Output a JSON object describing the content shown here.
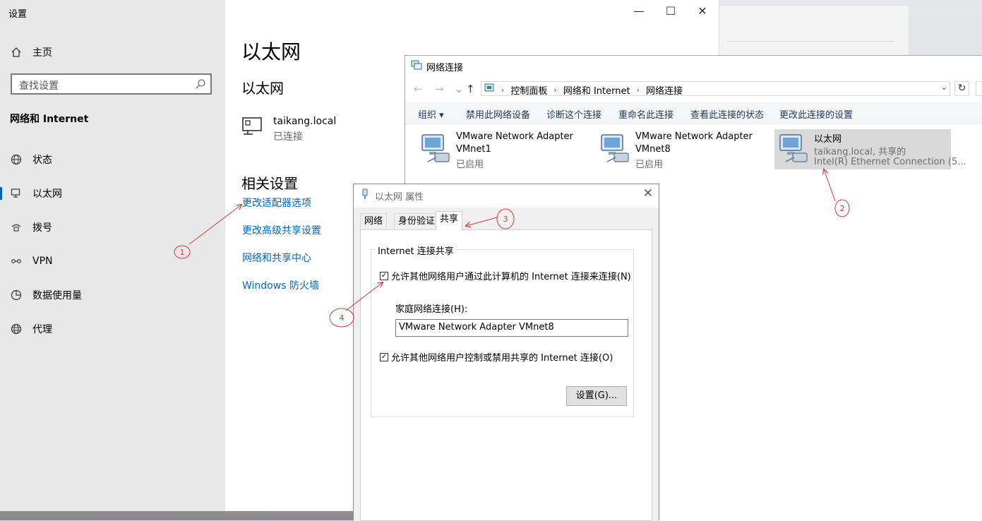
{
  "settings": {
    "window_title": "设置",
    "home_label": "主页",
    "search_placeholder": "查找设置",
    "section_title": "网络和 Internet",
    "nav": [
      {
        "label": "状态",
        "icon": "globe-status-icon"
      },
      {
        "label": "以太网",
        "icon": "ethernet-icon"
      },
      {
        "label": "拨号",
        "icon": "dialup-icon"
      },
      {
        "label": "VPN",
        "icon": "vpn-icon"
      },
      {
        "label": "数据使用量",
        "icon": "data-usage-icon"
      },
      {
        "label": "代理",
        "icon": "globe-proxy-icon"
      }
    ],
    "selected_nav": "以太网",
    "main": {
      "page_title": "以太网",
      "sub_title": "以太网",
      "network_name": "taikang.local",
      "network_status": "已连接",
      "related_title": "相关设置",
      "links": [
        "更改适配器选项",
        "更改高级共享设置",
        "网络和共享中心",
        "Windows 防火墙"
      ]
    }
  },
  "netconn": {
    "window_title": "网络连接",
    "breadcrumb": [
      "控制面板",
      "网络和 Internet",
      "网络连接"
    ],
    "commands": [
      "组织 ▾",
      "禁用此网络设备",
      "诊断这个连接",
      "重命名此连接",
      "查看此连接的状态",
      "更改此连接的设置"
    ],
    "adapters": [
      {
        "line1": "VMware Network Adapter",
        "line2": "VMnet1",
        "line3": "已启用"
      },
      {
        "line1": "VMware Network Adapter",
        "line2": "VMnet8",
        "line3": "已启用"
      },
      {
        "line1": "以太网",
        "line2": "taikang.local, 共享的",
        "line3": "Intel(R) Ethernet Connection (5..."
      }
    ]
  },
  "dialog": {
    "title": "以太网 属性",
    "tabs": [
      "网络",
      "身份验证",
      "共享"
    ],
    "active_tab": "共享",
    "group_title": "Internet 连接共享",
    "allow_connect_label": "允许其他网络用户通过此计算机的 Internet 连接来连接(N)",
    "allow_connect_checked": true,
    "home_network_label": "家庭网络连接(H):",
    "home_network_value": "VMware Network Adapter VMnet8",
    "allow_control_label": "允许其他网络用户控制或禁用共享的 Internet 连接(O)",
    "allow_control_checked": true,
    "settings_button": "设置(G)..."
  },
  "annotations": [
    "1",
    "2",
    "3",
    "4"
  ],
  "colors": {
    "link": "#0067b8",
    "accent": "#0063b1",
    "annotation": "#d33a3a"
  }
}
